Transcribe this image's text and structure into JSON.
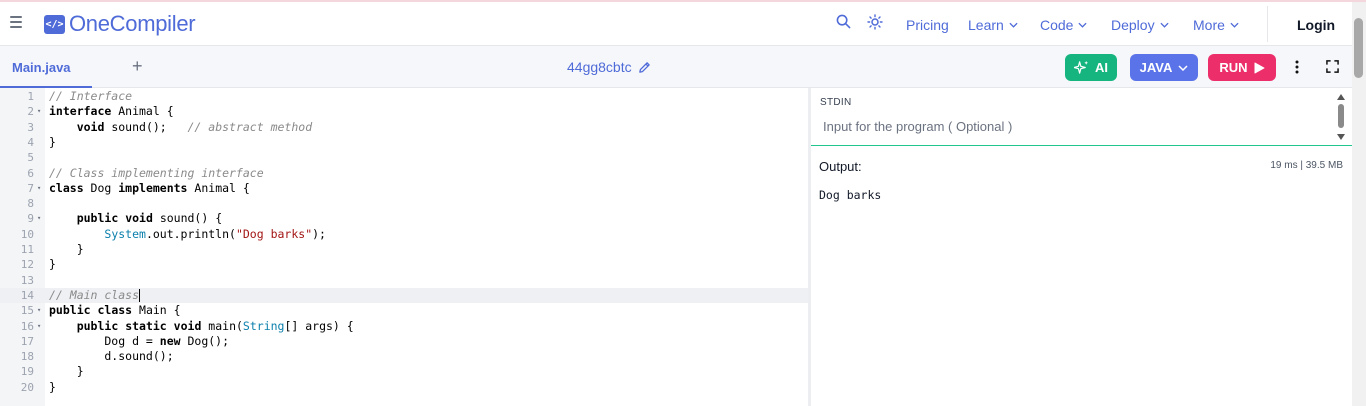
{
  "navbar": {
    "brand": "OneCompiler",
    "logo_glyph": "</>",
    "links": {
      "pricing": "Pricing",
      "learn": "Learn",
      "code": "Code",
      "deploy": "Deploy",
      "more": "More"
    },
    "login": "Login",
    "icons": [
      "menu-icon",
      "search-icon",
      "theme-sun-icon",
      "chevron-down-icon"
    ],
    "accent_color": "#4f6bd8"
  },
  "editor_header": {
    "tab_label": "Main.java",
    "add_tab": "+",
    "file_id": "44gg8cbtc",
    "ai_label": "AI",
    "language": "JAVA",
    "run_label": "RUN",
    "colors": {
      "ai": "#16b47e",
      "language": "#5b73e8",
      "run": "#ec2f6b"
    }
  },
  "code": {
    "language": "java",
    "lines": [
      "// Interface",
      "interface Animal {",
      "    void sound();   // abstract method",
      "}",
      "",
      "// Class implementing interface",
      "class Dog implements Animal {",
      "",
      "    public void sound() {",
      "        System.out.println(\"Dog barks\");",
      "    }",
      "}",
      "",
      "// Main class",
      "public class Main {",
      "    public static void main(String[] args) {",
      "        Dog d = new Dog();",
      "        d.sound();",
      "    }",
      "}"
    ],
    "active_line": 14,
    "foldable_lines": [
      2,
      7,
      9,
      15,
      16
    ]
  },
  "stdin": {
    "label": "STDIN",
    "placeholder": "Input for the program ( Optional )"
  },
  "output": {
    "label": "Output:",
    "stats": "19 ms | 39.5 MB",
    "text": "Dog barks"
  }
}
